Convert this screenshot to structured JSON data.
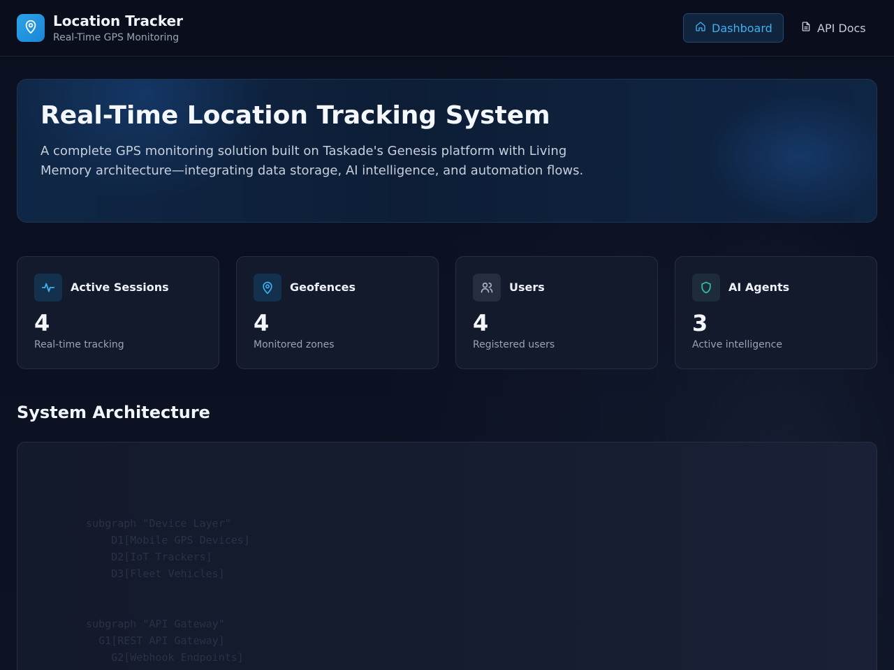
{
  "header": {
    "app_title": "Location Tracker",
    "app_subtitle": "Real-Time GPS Monitoring",
    "logo_icon": "map-pin-icon",
    "nav": [
      {
        "label": "Dashboard",
        "icon": "home-icon",
        "active": true
      },
      {
        "label": "API Docs",
        "icon": "document-icon",
        "active": false
      }
    ]
  },
  "hero": {
    "title": "Real-Time Location Tracking System",
    "description": "A complete GPS monitoring solution built on Taskade's Genesis platform with Living Memory architecture—integrating data storage, AI intelligence, and automation flows."
  },
  "stats": [
    {
      "title": "Active Sessions",
      "value": "4",
      "subtitle": "Real-time tracking",
      "icon": "activity-icon",
      "color": "#3fb0f0"
    },
    {
      "title": "Geofences",
      "value": "4",
      "subtitle": "Monitored zones",
      "icon": "map-pin-icon",
      "color": "#3fb0f0"
    },
    {
      "title": "Users",
      "value": "4",
      "subtitle": "Registered users",
      "icon": "users-icon",
      "color": "#aab4c8"
    },
    {
      "title": "AI Agents",
      "value": "3",
      "subtitle": "Active intelligence",
      "icon": "shield-icon",
      "color": "#2fc0b0"
    }
  ],
  "architecture": {
    "title": "System Architecture",
    "code_lines": [
      "",
      "",
      "  subgraph \"Device Layer\"",
      "      D1[Mobile GPS Devices]",
      "      D2[IoT Trackers]",
      "      D3[Fleet Vehicles]",
      "",
      "",
      "  subgraph \"API Gateway\"",
      "    G1[REST API Gateway]",
      "      G2[Webhook Endpoints]"
    ]
  },
  "colors": {
    "accent": "#3fb0f0",
    "background": "#0b1020",
    "card": "#131a2b"
  }
}
